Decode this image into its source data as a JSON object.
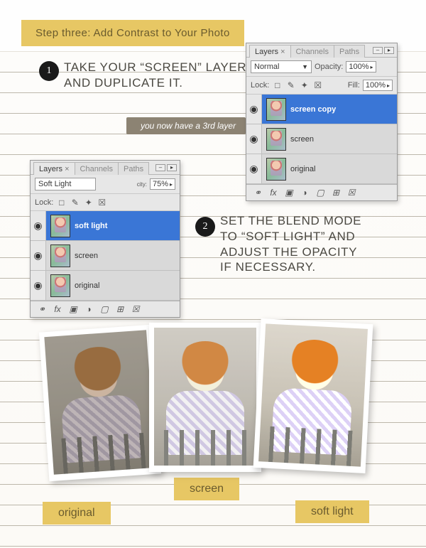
{
  "title": "Step three: Add Contrast to Your Photo",
  "steps": {
    "one": {
      "num": "1",
      "text": "TAKE YOUR “SCREEN” LAYER AND DUPLICATE IT."
    },
    "two": {
      "num": "2",
      "text": "SET THE BLEND MODE TO “SOFT LIGHT” AND ADJUST THE OPACITY IF NECESSARY."
    }
  },
  "callouts": {
    "third_layer": "you now have a 3rd layer",
    "soft_light": "soft light"
  },
  "panel_common": {
    "tabs": {
      "layers": "Layers",
      "channels": "Channels",
      "paths": "Paths"
    },
    "labels": {
      "opacity": "Opacity:",
      "fill": "Fill:",
      "lock": "Lock:"
    }
  },
  "panel1": {
    "blend_mode": "Normal",
    "opacity": "100%",
    "fill": "100%",
    "layers": [
      {
        "name": "screen copy",
        "selected": true
      },
      {
        "name": "screen",
        "selected": false
      },
      {
        "name": "original",
        "selected": false
      }
    ]
  },
  "panel2": {
    "blend_mode": "Soft Light",
    "opacity": "75%",
    "layers": [
      {
        "name": "soft light",
        "selected": true
      },
      {
        "name": "screen",
        "selected": false
      },
      {
        "name": "original",
        "selected": false
      }
    ]
  },
  "comparison": {
    "original": "original",
    "screen": "screen",
    "soft_light": "soft light"
  },
  "icons": {
    "eye": "◉",
    "fx": "fx",
    "link": "⚭",
    "mask": "▣",
    "adjust": "◑",
    "folder": "▢",
    "new": "⊞",
    "trash": "☒",
    "lock_brush": "✎",
    "lock_move": "✦",
    "lock_all": "□",
    "lock_pad": "☒"
  }
}
